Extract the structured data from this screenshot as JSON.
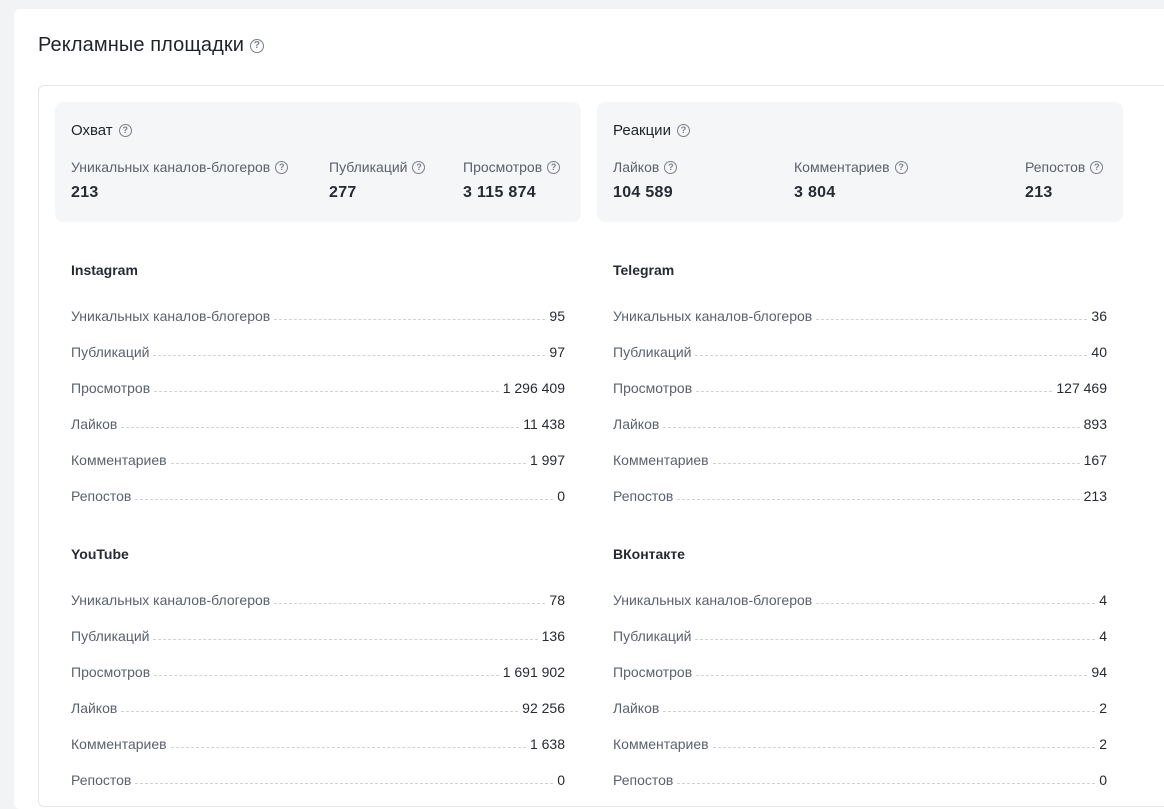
{
  "page": {
    "title": "Рекламные площадки"
  },
  "reach": {
    "title": "Охват",
    "metrics": [
      {
        "label": "Уникальных каналов-блогеров",
        "value": "213"
      },
      {
        "label": "Публикаций",
        "value": "277"
      },
      {
        "label": "Просмотров",
        "value": "3 115 874"
      }
    ]
  },
  "reactions": {
    "title": "Реакции",
    "metrics": [
      {
        "label": "Лайков",
        "value": "104 589"
      },
      {
        "label": "Комментариев",
        "value": "3 804"
      },
      {
        "label": "Репостов",
        "value": "213"
      }
    ]
  },
  "platforms": [
    {
      "name": "Instagram",
      "rows": [
        {
          "label": "Уникальных каналов-блогеров",
          "value": "95"
        },
        {
          "label": "Публикаций",
          "value": "97"
        },
        {
          "label": "Просмотров",
          "value": "1 296 409"
        },
        {
          "label": "Лайков",
          "value": "11 438"
        },
        {
          "label": "Комментариев",
          "value": "1 997"
        },
        {
          "label": "Репостов",
          "value": "0"
        }
      ]
    },
    {
      "name": "Telegram",
      "rows": [
        {
          "label": "Уникальных каналов-блогеров",
          "value": "36"
        },
        {
          "label": "Публикаций",
          "value": "40"
        },
        {
          "label": "Просмотров",
          "value": "127 469"
        },
        {
          "label": "Лайков",
          "value": "893"
        },
        {
          "label": "Комментариев",
          "value": "167"
        },
        {
          "label": "Репостов",
          "value": "213"
        }
      ]
    },
    {
      "name": "YouTube",
      "rows": [
        {
          "label": "Уникальных каналов-блогеров",
          "value": "78"
        },
        {
          "label": "Публикаций",
          "value": "136"
        },
        {
          "label": "Просмотров",
          "value": "1 691 902"
        },
        {
          "label": "Лайков",
          "value": "92 256"
        },
        {
          "label": "Комментариев",
          "value": "1 638"
        },
        {
          "label": "Репостов",
          "value": "0"
        }
      ]
    },
    {
      "name": "ВКонтакте",
      "rows": [
        {
          "label": "Уникальных каналов-блогеров",
          "value": "4"
        },
        {
          "label": "Публикаций",
          "value": "4"
        },
        {
          "label": "Просмотров",
          "value": "94"
        },
        {
          "label": "Лайков",
          "value": "2"
        },
        {
          "label": "Комментариев",
          "value": "2"
        },
        {
          "label": "Репостов",
          "value": "0"
        }
      ]
    }
  ],
  "icons": {
    "help": "question-circle-icon"
  },
  "colors": {
    "background": "#f2f3f5",
    "card": "#f5f6f8",
    "text": "#1f2329",
    "muted": "#5b616b"
  }
}
